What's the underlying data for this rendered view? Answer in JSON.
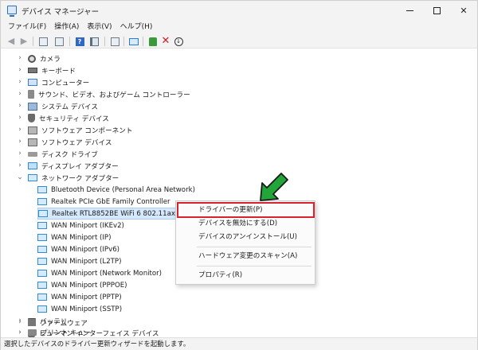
{
  "window": {
    "title": "デバイス マネージャー"
  },
  "menu": [
    "ファイル(F)",
    "操作(A)",
    "表示(V)",
    "ヘルプ(H)"
  ],
  "tree": {
    "categories": [
      {
        "label": "カメラ",
        "icon": "camera-icon",
        "expanded": false
      },
      {
        "label": "キーボード",
        "icon": "keyboard-icon",
        "expanded": false
      },
      {
        "label": "コンピューター",
        "icon": "computer-icon",
        "expanded": false
      },
      {
        "label": "サウンド、ビデオ、およびゲーム コントローラー",
        "icon": "sound-icon",
        "expanded": false
      },
      {
        "label": "システム デバイス",
        "icon": "system-device-icon",
        "expanded": false
      },
      {
        "label": "セキュリティ デバイス",
        "icon": "security-device-icon",
        "expanded": false
      },
      {
        "label": "ソフトウェア コンポーネント",
        "icon": "software-component-icon",
        "expanded": false
      },
      {
        "label": "ソフトウェア デバイス",
        "icon": "software-device-icon",
        "expanded": false
      },
      {
        "label": "ディスク ドライブ",
        "icon": "disk-drive-icon",
        "expanded": false
      },
      {
        "label": "ディスプレイ アダプター",
        "icon": "display-adapter-icon",
        "expanded": false
      },
      {
        "label": "ネットワーク アダプター",
        "icon": "network-adapter-icon",
        "expanded": true
      }
    ],
    "network_devices": [
      "Bluetooth Device (Personal Area Network)",
      "Realtek PCIe GbE Family Controller",
      "Realtek RTL8852BE WiFi 6 802.11ax PCIe Adapter",
      "WAN Miniport (IKEv2)",
      "WAN Miniport (IP)",
      "WAN Miniport (IPv6)",
      "WAN Miniport (L2TP)",
      "WAN Miniport (Network Monitor)",
      "WAN Miniport (PPPOE)",
      "WAN Miniport (PPTP)",
      "WAN Miniport (SSTP)"
    ],
    "selected_device_index": 2,
    "after_categories": [
      {
        "label": "バッテリ",
        "icon": "battery-icon"
      },
      {
        "label": "ヒューマン インターフェイス デバイス",
        "icon": "hid-icon"
      },
      {
        "label": "ファームウェア",
        "icon": "firmware-icon"
      },
      {
        "label": "プリント キュー",
        "icon": "print-queue-icon"
      }
    ]
  },
  "context_menu": {
    "items": [
      "ドライバーの更新(P)",
      "デバイスを無効にする(D)",
      "デバイスのアンインストール(U)",
      "ハードウェア変更のスキャン(A)",
      "プロパティ(R)"
    ],
    "highlighted_index": 0
  },
  "annotation": {
    "arrow_color": "#22a63a",
    "highlight_color": "#d8222f"
  },
  "status_bar": {
    "text": "選択したデバイスのドライバー更新ウィザードを起動します。"
  }
}
